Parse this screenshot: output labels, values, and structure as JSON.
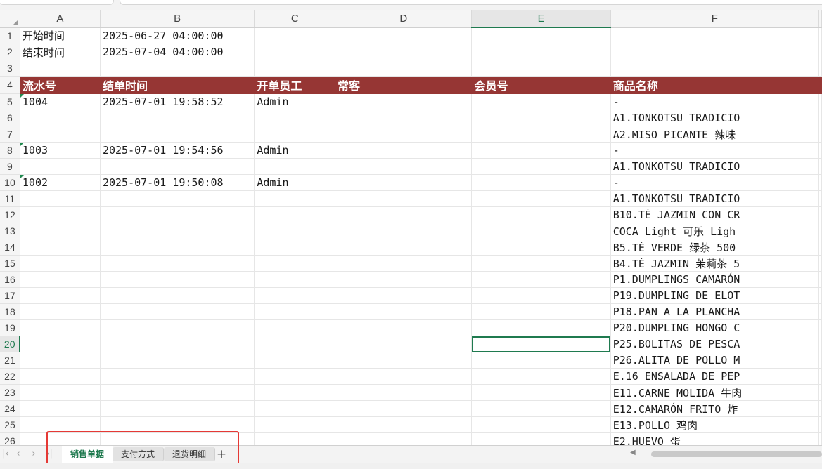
{
  "columns": [
    "A",
    "B",
    "C",
    "D",
    "E",
    "F"
  ],
  "active_column": "E",
  "active_row": "20",
  "rows": [
    {
      "n": "1",
      "cells": [
        "开始时间",
        "2025-06-27 04:00:00",
        "",
        "",
        "",
        ""
      ]
    },
    {
      "n": "2",
      "cells": [
        "结束时间",
        "2025-07-04 04:00:00",
        "",
        "",
        "",
        ""
      ]
    },
    {
      "n": "3",
      "cells": [
        "",
        "",
        "",
        "",
        "",
        ""
      ]
    },
    {
      "n": "4",
      "cells": [
        "流水号",
        "结单时间",
        "开单员工",
        "常客",
        "会员号",
        "商品名称"
      ],
      "header": true
    },
    {
      "n": "5",
      "cells": [
        "1004",
        "2025-07-01 19:58:52",
        "Admin",
        "",
        "",
        "-"
      ]
    },
    {
      "n": "6",
      "cells": [
        "",
        "",
        "",
        "",
        "",
        "A1.TONKOTSU TRADICIO"
      ]
    },
    {
      "n": "7",
      "cells": [
        "",
        "",
        "",
        "",
        "",
        "A2.MISO PICANTE 辣味"
      ]
    },
    {
      "n": "8",
      "cells": [
        "1003",
        "2025-07-01 19:54:56",
        "Admin",
        "",
        "",
        "-"
      ]
    },
    {
      "n": "9",
      "cells": [
        "",
        "",
        "",
        "",
        "",
        "A1.TONKOTSU TRADICIO"
      ]
    },
    {
      "n": "10",
      "cells": [
        "1002",
        "2025-07-01 19:50:08",
        "Admin",
        "",
        "",
        "-"
      ]
    },
    {
      "n": "11",
      "cells": [
        "",
        "",
        "",
        "",
        "",
        "A1.TONKOTSU TRADICIO"
      ]
    },
    {
      "n": "12",
      "cells": [
        "",
        "",
        "",
        "",
        "",
        "B10.TÉ JAZMIN CON CR"
      ]
    },
    {
      "n": "13",
      "cells": [
        "",
        "",
        "",
        "",
        "",
        "COCA Light 可乐 Ligh"
      ]
    },
    {
      "n": "14",
      "cells": [
        "",
        "",
        "",
        "",
        "",
        "B5.TÉ VERDE 绿茶 500"
      ]
    },
    {
      "n": "15",
      "cells": [
        "",
        "",
        "",
        "",
        "",
        "B4.TÉ JAZMIN 茉莉茶 5"
      ]
    },
    {
      "n": "16",
      "cells": [
        "",
        "",
        "",
        "",
        "",
        "P1.DUMPLINGS CAMARÓN"
      ]
    },
    {
      "n": "17",
      "cells": [
        "",
        "",
        "",
        "",
        "",
        "P19.DUMPLING DE ELOT"
      ]
    },
    {
      "n": "18",
      "cells": [
        "",
        "",
        "",
        "",
        "",
        "P18.PAN A LA PLANCHA"
      ]
    },
    {
      "n": "19",
      "cells": [
        "",
        "",
        "",
        "",
        "",
        "P20.DUMPLING HONGO C"
      ]
    },
    {
      "n": "20",
      "cells": [
        "",
        "",
        "",
        "",
        "",
        "P25.BOLITAS DE PESCA"
      ]
    },
    {
      "n": "21",
      "cells": [
        "",
        "",
        "",
        "",
        "",
        "P26.ALITA DE POLLO M"
      ]
    },
    {
      "n": "22",
      "cells": [
        "",
        "",
        "",
        "",
        "",
        "E.16 ENSALADA DE PEP"
      ]
    },
    {
      "n": "23",
      "cells": [
        "",
        "",
        "",
        "",
        "",
        "E11.CARNE MOLIDA 牛肉"
      ]
    },
    {
      "n": "24",
      "cells": [
        "",
        "",
        "",
        "",
        "",
        "E12.CAMARÓN FRITO 炸"
      ]
    },
    {
      "n": "25",
      "cells": [
        "",
        "",
        "",
        "",
        "",
        "E13.POLLO 鸡肉"
      ]
    },
    {
      "n": "26",
      "cells": [
        "",
        "",
        "",
        "",
        "",
        "E2.HUEVO 蛋"
      ]
    }
  ],
  "sheet_tabs": [
    {
      "label": "销售单据",
      "active": true
    },
    {
      "label": "支付方式",
      "active": false
    },
    {
      "label": "退货明细",
      "active": false
    }
  ],
  "add_sheet_label": "+",
  "colors": {
    "header_fill": "#963634",
    "accent": "#1f7a4f",
    "highlight_box": "#e53935"
  }
}
